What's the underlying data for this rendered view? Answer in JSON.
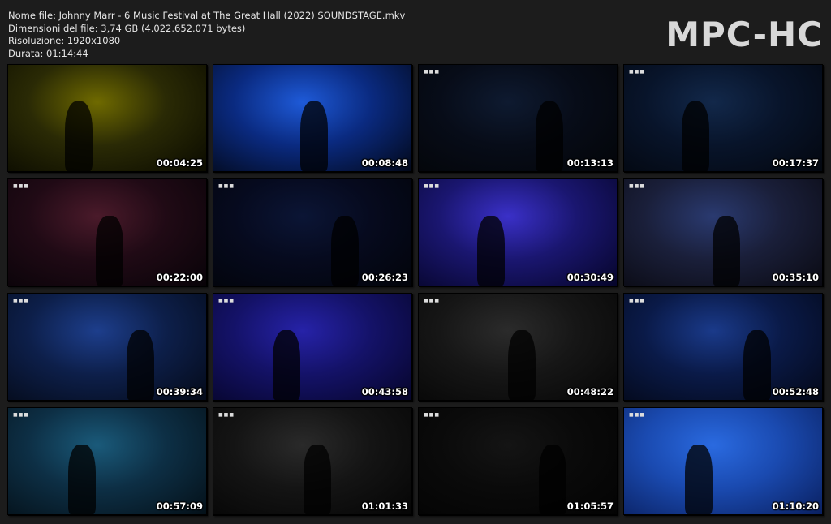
{
  "file_info": {
    "name_line": "Nome file: Johnny Marr - 6 Music Festival at The Great Hall (2022) SOUNDSTAGE.mkv",
    "size_line": "Dimensioni del file: 3,74 GB (4.022.652.071 bytes)",
    "resolution_line": "Risoluzione: 1920x1080",
    "duration_line": "Durata: 01:14:44"
  },
  "brand": "MPC-HC",
  "thumbnails": [
    {
      "timecode": "00:04:25",
      "colors": [
        "#6f6a00",
        "#2a2a05",
        "#0a0a00"
      ]
    },
    {
      "timecode": "00:08:48",
      "colors": [
        "#1e5ad8",
        "#0a2a80",
        "#020818"
      ]
    },
    {
      "timecode": "00:13:13",
      "colors": [
        "#0e1a30",
        "#070c18",
        "#030508"
      ]
    },
    {
      "timecode": "00:17:37",
      "colors": [
        "#12284a",
        "#08142a",
        "#03070f"
      ]
    },
    {
      "timecode": "00:22:00",
      "colors": [
        "#4a1a2a",
        "#200a15",
        "#080308"
      ]
    },
    {
      "timecode": "00:26:23",
      "colors": [
        "#0b1535",
        "#060a1e",
        "#02040a"
      ]
    },
    {
      "timecode": "00:30:49",
      "colors": [
        "#3a30c8",
        "#1a1670",
        "#06052a"
      ]
    },
    {
      "timecode": "00:35:10",
      "colors": [
        "#2a3a70",
        "#1a1f3a",
        "#0a0a12"
      ]
    },
    {
      "timecode": "00:39:34",
      "colors": [
        "#1d3e8c",
        "#0d1f4a",
        "#040a18"
      ]
    },
    {
      "timecode": "00:43:58",
      "colors": [
        "#2622a8",
        "#141268",
        "#06052a"
      ]
    },
    {
      "timecode": "00:48:22",
      "colors": [
        "#2b2b2b",
        "#161616",
        "#060606"
      ]
    },
    {
      "timecode": "00:52:48",
      "colors": [
        "#1a3a8a",
        "#0a1a48",
        "#030818"
      ]
    },
    {
      "timecode": "00:57:09",
      "colors": [
        "#1a5a7a",
        "#0d2f45",
        "#041018"
      ]
    },
    {
      "timecode": "01:01:33",
      "colors": [
        "#2a2a2a",
        "#141414",
        "#050505"
      ]
    },
    {
      "timecode": "01:05:57",
      "colors": [
        "#141414",
        "#0a0a0a",
        "#030303"
      ]
    },
    {
      "timecode": "01:10:20",
      "colors": [
        "#2a6ae0",
        "#1a4ab0",
        "#0a2060"
      ]
    }
  ]
}
